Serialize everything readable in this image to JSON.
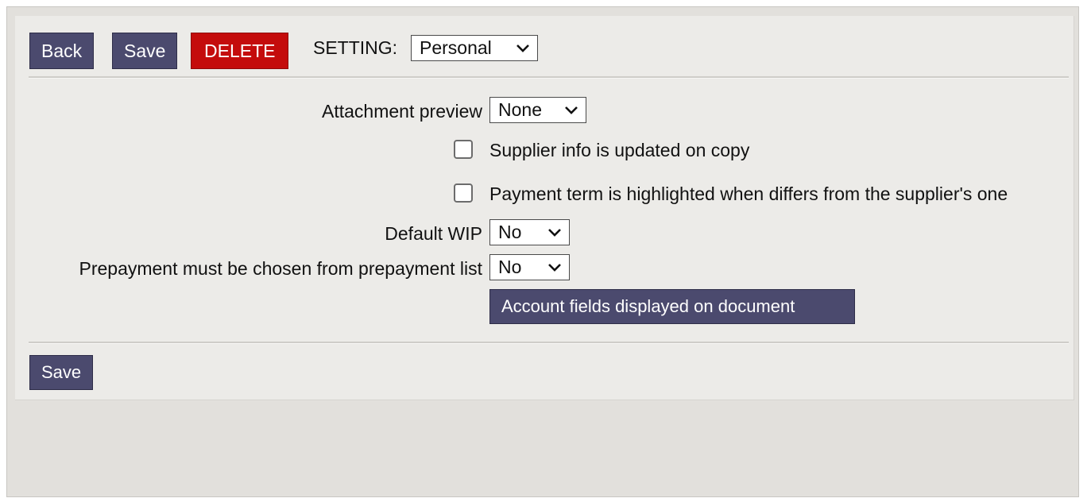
{
  "toolbar": {
    "back_label": "Back",
    "save_label": "Save",
    "delete_label": "DELETE",
    "setting_label": "SETTING:",
    "setting_value": "Personal"
  },
  "form": {
    "attachment_preview": {
      "label": "Attachment preview",
      "value": "None"
    },
    "supplier_info_checkbox": {
      "label": "Supplier info is updated on copy",
      "checked": false
    },
    "payment_term_checkbox": {
      "label": "Payment term is highlighted when differs from the supplier's one",
      "checked": false
    },
    "default_wip": {
      "label": "Default WIP",
      "value": "No"
    },
    "prepayment_list": {
      "label": "Prepayment must be chosen from prepayment list",
      "value": "No"
    },
    "account_fields_button": "Account fields displayed on document"
  },
  "footer": {
    "save_label": "Save"
  },
  "colors": {
    "button_bg": "#4b4a6e",
    "delete_bg": "#c40c0c",
    "panel_bg": "#ecebe8",
    "frame_bg": "#e2e0dc"
  }
}
